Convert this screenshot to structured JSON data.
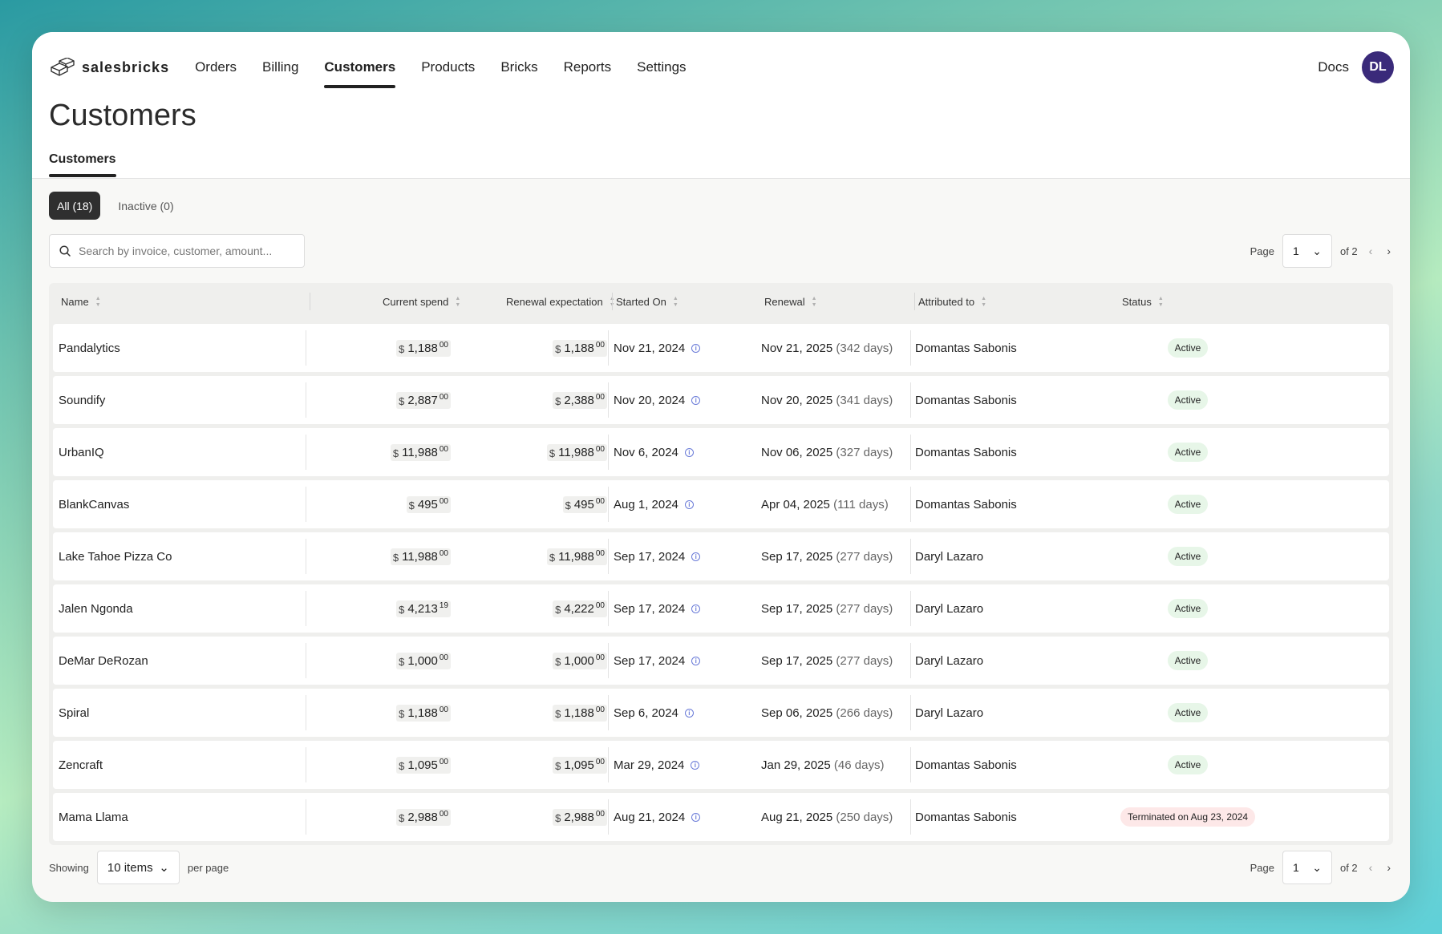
{
  "app": {
    "name": "salesbricks"
  },
  "nav": {
    "items": [
      "Orders",
      "Billing",
      "Customers",
      "Products",
      "Bricks",
      "Reports",
      "Settings"
    ],
    "docs": "Docs",
    "avatar_initials": "DL"
  },
  "page": {
    "title": "Customers",
    "subtab": "Customers"
  },
  "filters": {
    "all": "All (18)",
    "inactive": "Inactive (0)"
  },
  "search": {
    "placeholder": "Search by invoice, customer, amount..."
  },
  "pager": {
    "label": "Page",
    "current": "1",
    "of": "of 2"
  },
  "footer": {
    "showing": "Showing",
    "items": "10 items",
    "per_page": "per page"
  },
  "table": {
    "headers": {
      "name": "Name",
      "current_spend": "Current spend",
      "renewal_expectation": "Renewal expectation",
      "started_on": "Started On",
      "renewal": "Renewal",
      "attributed_to": "Attributed to",
      "status": "Status"
    },
    "rows": [
      {
        "name": "Pandalytics",
        "spend": "1,188",
        "spend_c": "00",
        "renew": "1,188",
        "renew_c": "00",
        "started": "Nov 21, 2024",
        "renewal_date": "Nov 21, 2025",
        "renewal_days": "(342 days)",
        "attributed": "Domantas Sabonis",
        "status": "Active"
      },
      {
        "name": "Soundify",
        "spend": "2,887",
        "spend_c": "00",
        "renew": "2,388",
        "renew_c": "00",
        "started": "Nov 20, 2024",
        "renewal_date": "Nov 20, 2025",
        "renewal_days": "(341 days)",
        "attributed": "Domantas Sabonis",
        "status": "Active"
      },
      {
        "name": "UrbanIQ",
        "spend": "11,988",
        "spend_c": "00",
        "renew": "11,988",
        "renew_c": "00",
        "started": "Nov 6, 2024",
        "renewal_date": "Nov 06, 2025",
        "renewal_days": "(327 days)",
        "attributed": "Domantas Sabonis",
        "status": "Active"
      },
      {
        "name": "BlankCanvas",
        "spend": "495",
        "spend_c": "00",
        "renew": "495",
        "renew_c": "00",
        "started": "Aug 1, 2024",
        "renewal_date": "Apr 04, 2025",
        "renewal_days": "(111 days)",
        "attributed": "Domantas Sabonis",
        "status": "Active"
      },
      {
        "name": "Lake Tahoe Pizza Co",
        "spend": "11,988",
        "spend_c": "00",
        "renew": "11,988",
        "renew_c": "00",
        "started": "Sep 17, 2024",
        "renewal_date": "Sep 17, 2025",
        "renewal_days": "(277 days)",
        "attributed": "Daryl Lazaro",
        "status": "Active"
      },
      {
        "name": "Jalen Ngonda",
        "spend": "4,213",
        "spend_c": "19",
        "renew": "4,222",
        "renew_c": "00",
        "started": "Sep 17, 2024",
        "renewal_date": "Sep 17, 2025",
        "renewal_days": "(277 days)",
        "attributed": "Daryl Lazaro",
        "status": "Active"
      },
      {
        "name": "DeMar DeRozan",
        "spend": "1,000",
        "spend_c": "00",
        "renew": "1,000",
        "renew_c": "00",
        "started": "Sep 17, 2024",
        "renewal_date": "Sep 17, 2025",
        "renewal_days": "(277 days)",
        "attributed": "Daryl Lazaro",
        "status": "Active"
      },
      {
        "name": "Spiral",
        "spend": "1,188",
        "spend_c": "00",
        "renew": "1,188",
        "renew_c": "00",
        "started": "Sep 6, 2024",
        "renewal_date": "Sep 06, 2025",
        "renewal_days": "(266 days)",
        "attributed": "Daryl Lazaro",
        "status": "Active"
      },
      {
        "name": "Zencraft",
        "spend": "1,095",
        "spend_c": "00",
        "renew": "1,095",
        "renew_c": "00",
        "started": "Mar 29, 2024",
        "renewal_date": "Jan 29, 2025",
        "renewal_days": "(46 days)",
        "attributed": "Domantas Sabonis",
        "status": "Active"
      },
      {
        "name": "Mama Llama",
        "spend": "2,988",
        "spend_c": "00",
        "renew": "2,988",
        "renew_c": "00",
        "started": "Aug 21, 2024",
        "renewal_date": "Aug 21, 2025",
        "renewal_days": "(250 days)",
        "attributed": "Domantas Sabonis",
        "status": "Terminated on Aug 23, 2024",
        "status_type": "terminated"
      }
    ]
  },
  "colors": {
    "avatar": "#3a2a7a",
    "active_badge": "#e7f6e8",
    "terminated_badge": "#fde8e8",
    "info_icon": "#6a7bd8"
  },
  "currency_symbol": "$"
}
